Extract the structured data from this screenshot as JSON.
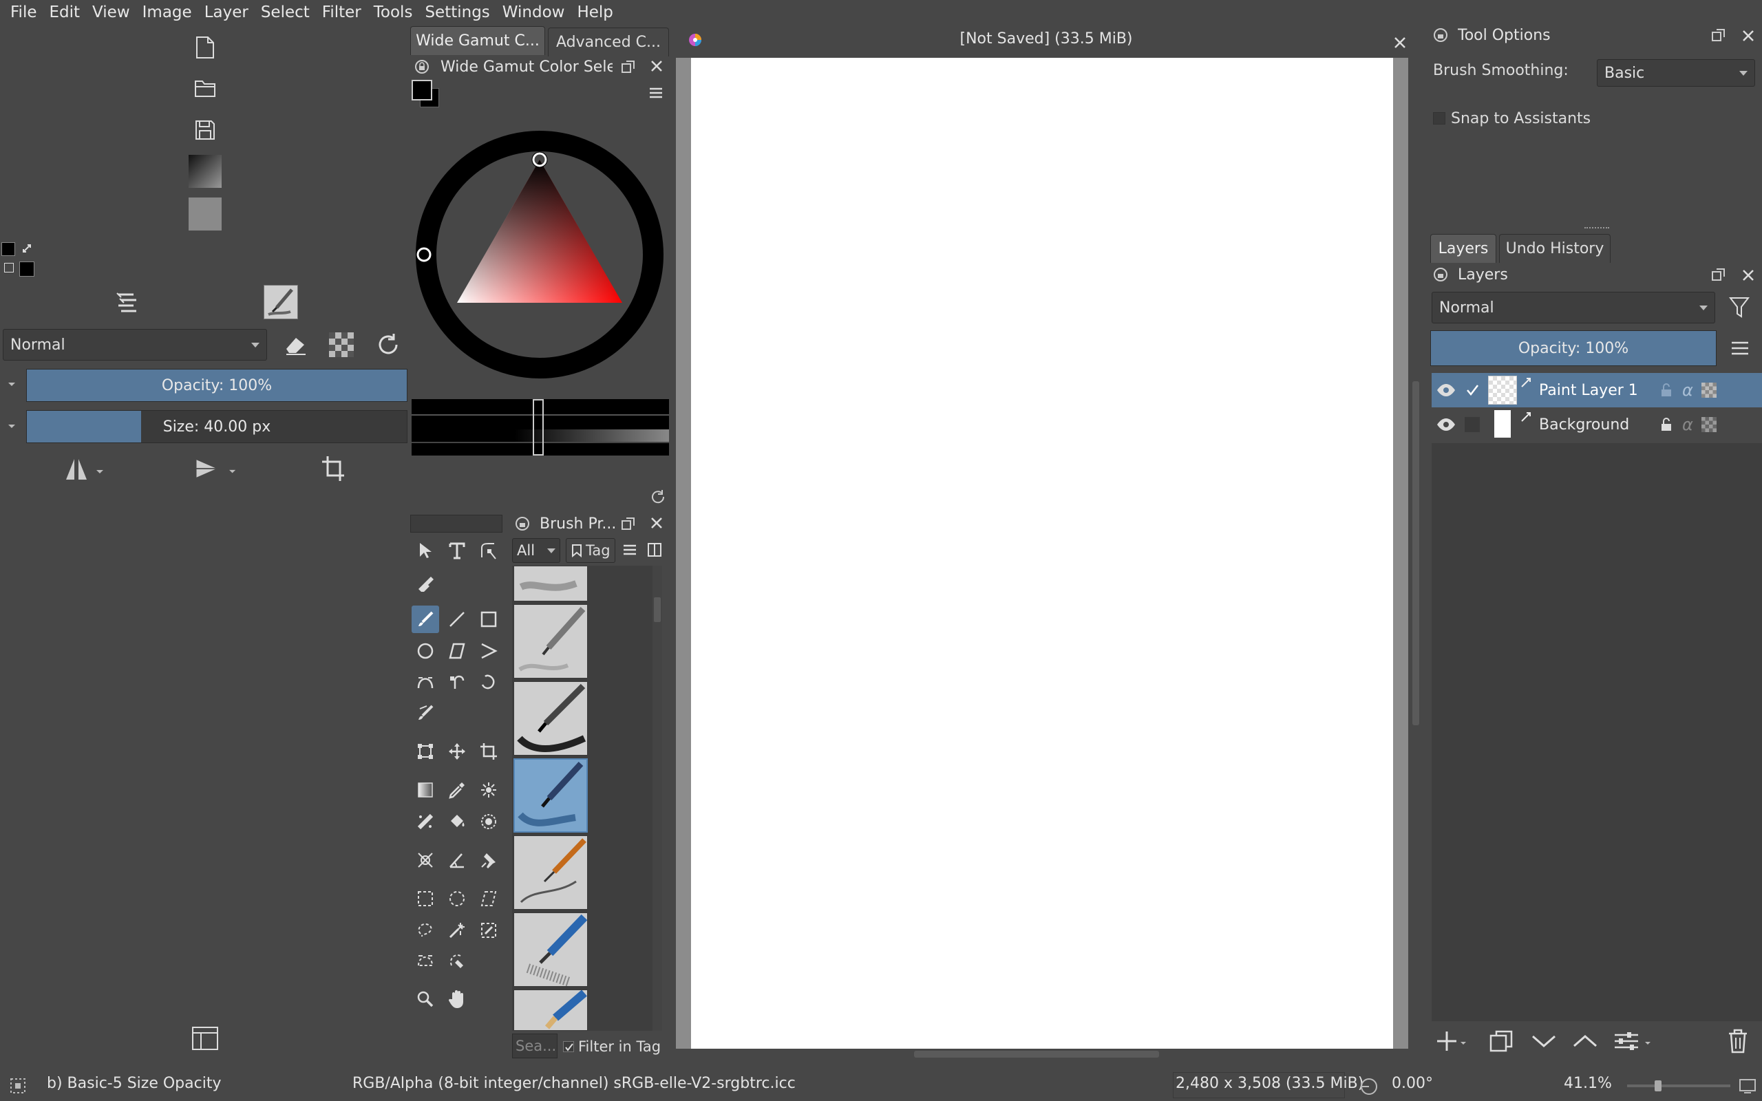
{
  "menu": [
    "File",
    "Edit",
    "View",
    "Image",
    "Layer",
    "Select",
    "Filter",
    "Tools",
    "Settings",
    "Window",
    "Help"
  ],
  "left": {
    "blend_mode": "Normal",
    "opacity_label": "Opacity: 100%",
    "opacity_value": 1.0,
    "size_label": "Size: 40.00 px",
    "size_value": 0.3
  },
  "color_tabs": [
    "Wide Gamut C...",
    "Advanced C..."
  ],
  "color_docker_title": "Wide Gamut Color Sele...",
  "brush_docker": {
    "title": "Brush Pr...",
    "filter_value": "All",
    "tag_label": "Tag",
    "search_placeholder": "Sea...",
    "filter_in_tag_label": "Filter in Tag"
  },
  "canvas": {
    "title": "[Not Saved]  (33.5 MiB)"
  },
  "tool_options": {
    "title": "Tool Options",
    "brush_smoothing_label": "Brush Smoothing:",
    "brush_smoothing_value": "Basic",
    "snap_label": "Snap to Assistants"
  },
  "layers_tabs": [
    "Layers",
    "Undo History"
  ],
  "layers": {
    "title": "Layers",
    "blend_mode": "Normal",
    "opacity_label": "Opacity: 100%",
    "opacity_value": 1.0,
    "items": [
      {
        "name": "Paint Layer 1",
        "selected": true,
        "locked": false
      },
      {
        "name": "Background",
        "selected": false,
        "locked": true
      }
    ]
  },
  "status": {
    "brush_preset": "b) Basic-5 Size Opacity",
    "color_space": "RGB/Alpha (8-bit integer/channel)  sRGB-elle-V2-srgbtrc.icc",
    "image_size": "2,480 x 3,508 (33.5 MiB)",
    "rotation": "0.00°",
    "zoom": "41.1%"
  },
  "colors": {
    "accent": "#56789a",
    "panel": "#474747",
    "canvas": "#ffffff"
  }
}
